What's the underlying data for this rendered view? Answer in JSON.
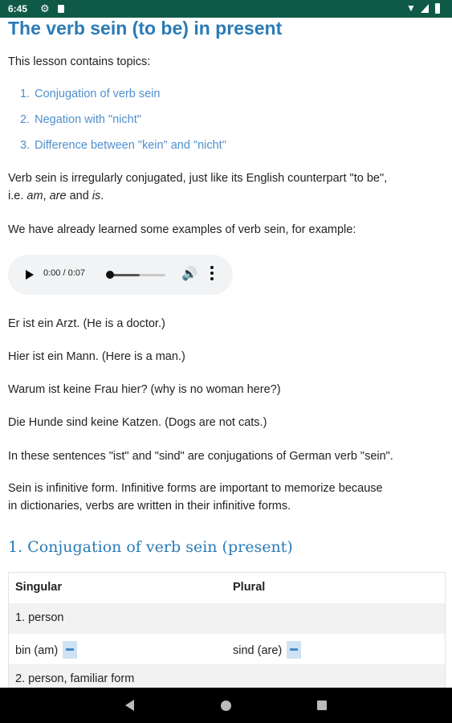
{
  "status_bar": {
    "time": "6:45",
    "icons": [
      "gear-icon",
      "sd-card-icon",
      "wifi-icon",
      "signal-icon",
      "battery-icon"
    ],
    "color": "#0f5a46"
  },
  "lesson": {
    "title": "The verb sein (to be) in present",
    "intro": "This lesson contains topics:",
    "topics": [
      {
        "num": "1.",
        "label": "Conjugation of verb sein"
      },
      {
        "num": "2.",
        "label": "Negation with \"nicht\""
      },
      {
        "num": "3.",
        "label": "Difference between \"kein\" and \"nicht\""
      }
    ],
    "para1": {
      "line1": "Verb sein is irregularly conjugated, just like its English counterpart \"to be\",",
      "line2_prefix": "i.e. ",
      "am": "am",
      "sep1": ", ",
      "are": "are",
      "and": " and ",
      "is": "is",
      "end": "."
    },
    "para2": "We have already learned some examples of verb sein, for example:",
    "audio": {
      "time": "0:00 / 0:07",
      "progress": 0.0
    },
    "examples": [
      "Er ist ein Arzt. (He is a doctor.)",
      "Hier ist ein Mann. (Here is a man.)",
      "Warum ist keine Frau hier? (why is no woman here?)",
      "Die Hunde sind keine Katzen. (Dogs are not cats.)"
    ],
    "para3": "In these sentences \"ist\" and \"sind\" are conjugations of German verb \"sein\".",
    "para4_line1": "Sein is infinitive form. Infinitive forms are important to memorize because",
    "para4_line2": "in dictionaries, verbs are written in their infinitive forms.",
    "section1_title": "1. Conjugation of verb sein (present)"
  },
  "table": {
    "headers": [
      "Singular",
      "Plural"
    ],
    "rows": [
      {
        "c1": "1. person",
        "c2": ""
      },
      {
        "c1": "bin (am)",
        "c2": "sind (are)"
      },
      {
        "c1": "2. person, familiar form",
        "c2": ""
      }
    ]
  },
  "colors": {
    "heading": "#2a7bb5",
    "link": "#4f8fcf",
    "statusbar": "#0f5a46"
  }
}
